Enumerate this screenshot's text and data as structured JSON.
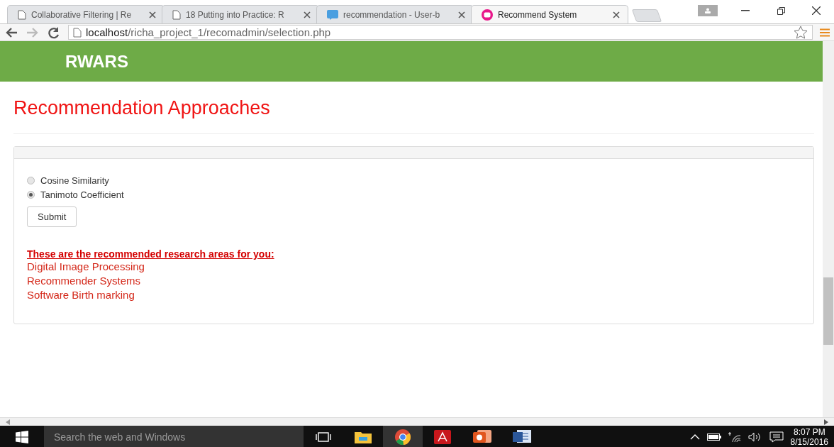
{
  "browser": {
    "tabs": [
      {
        "title": "Collaborative Filtering | Re",
        "kind": "page",
        "selected": false
      },
      {
        "title": "18 Putting into Practice: R",
        "kind": "page",
        "selected": false
      },
      {
        "title": "recommendation - User-b",
        "kind": "ds",
        "selected": false
      },
      {
        "title": "Recommend System",
        "kind": "w",
        "selected": true
      }
    ],
    "address": {
      "host": "localhost",
      "path": "/richa_project_1/recomadmin/selection.php"
    }
  },
  "page": {
    "brand": "RWARS",
    "heading": "Recommendation Approaches",
    "options": [
      {
        "label": "Cosine Similarity",
        "selected": false
      },
      {
        "label": "Tanimoto Coefficient",
        "selected": true
      }
    ],
    "submit": "Submit",
    "result_title": "These are the recommended research areas for you:",
    "results": [
      "Digital Image Processing",
      "Recommender Systems",
      "Software Birth marking"
    ]
  },
  "taskbar": {
    "search_placeholder": "Search the web and Windows",
    "time": "8:07 PM",
    "date": "8/15/2016"
  }
}
